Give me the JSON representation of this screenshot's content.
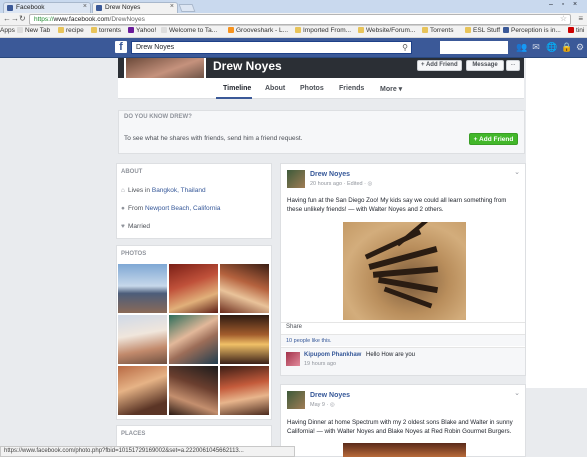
{
  "browser": {
    "tabs": [
      {
        "label": "Facebook",
        "active": false
      },
      {
        "label": "Drew Noyes",
        "active": true
      }
    ],
    "url_secure": "https://",
    "url_host": "www.facebook.com",
    "url_path": "/DrewNoyes",
    "bookmarks": [
      "Apps",
      "New Tab",
      "recipe",
      "torrents",
      "Yahoo!",
      "Welcome to Ta...",
      "Grooveshark - L...",
      "Imported From...",
      "Website/Forum...",
      "Torrents",
      "ESL Stuff",
      "Perception is in...",
      "tini"
    ],
    "status_url": "https://www.facebook.com/photo.php?fbid=10151729169002&set=a.2220061045662113..."
  },
  "fb_header": {
    "search_value": "Drew Noyes"
  },
  "profile": {
    "name": "Drew Noyes",
    "add_friend": "Add Friend",
    "message": "Message",
    "more": "...",
    "tabs": [
      "Timeline",
      "About",
      "Photos",
      "Friends",
      "More ▾"
    ],
    "active_tab": "Timeline"
  },
  "know": {
    "title": "DO YOU KNOW DREW?",
    "text": "To see what he shares with friends, send him a friend request.",
    "button": "Add Friend"
  },
  "about": {
    "title": "ABOUT",
    "rows": [
      {
        "icon": "home-icon",
        "prefix": "Lives in ",
        "link": "Bangkok, Thailand"
      },
      {
        "icon": "pin-icon",
        "prefix": "From ",
        "link": "Newport Beach, California"
      },
      {
        "icon": "heart-icon",
        "prefix": "Married",
        "link": ""
      }
    ]
  },
  "photos": {
    "title": "PHOTOS"
  },
  "places": {
    "title": "PLACES"
  },
  "post1": {
    "author": "Drew Noyes",
    "meta": "20 hours ago · Edited · ◎",
    "text1": "Having fun at the San Diego Zoo! My kids say we could all learn something from",
    "text2": "these unlikely friends! — with Walter Noyes and 2 others.",
    "share": "Share",
    "likes": "10 people like this.",
    "commenter": "Kipupom Phankhaw",
    "comment": "Hello How are you",
    "comment_time": "19 hours ago"
  },
  "post2": {
    "author": "Drew Noyes",
    "meta": "May 9 · ◎",
    "text1": "Having Dinner at home Spectrum with my 2 oldest sons Blake and Walter in sunny",
    "text2": "California! — with Walter Noyes and Blake Noyes at Red Robin Gourmet Burgers."
  },
  "colors": {
    "fb_blue": "#3b5998",
    "link": "#365899",
    "green": "#42b72a",
    "page_bg": "#e9ebee"
  }
}
